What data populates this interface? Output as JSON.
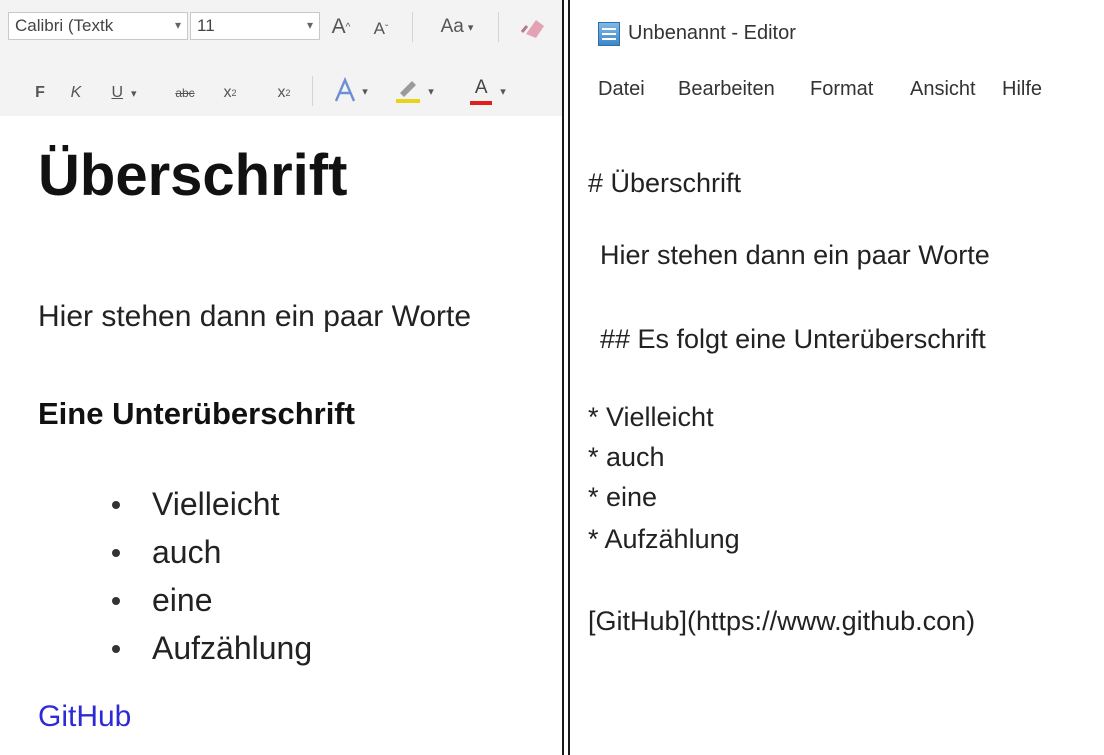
{
  "word": {
    "font_name": "Calibri (Textk",
    "font_size": "11",
    "grow_font": "A",
    "shrink_font": "A",
    "change_case": "Aa",
    "bold": "F",
    "italic": "K",
    "underline": "U",
    "strikethrough": "abc",
    "subscript": "x",
    "superscript": "x",
    "font_color_glyph": "A",
    "heading1": "Überschrift",
    "paragraph": "Hier stehen dann ein paar Worte",
    "heading2": "Eine Unterüberschrift",
    "list": [
      "Vielleicht",
      "auch",
      "eine",
      "Aufzählung"
    ],
    "link": "GitHub",
    "colors": {
      "font_color_underline": "#e0201b",
      "highlight": "#e8d31a",
      "link": "#2e2bd6"
    }
  },
  "notepad": {
    "title": "Unbenannt - Editor",
    "menu": [
      "Datei",
      "Bearbeiten",
      "Format",
      "Ansicht",
      "Hilfe"
    ],
    "lines": [
      "# Überschrift",
      "Hier stehen dann ein paar Worte",
      "## Es folgt eine Unterüberschrift",
      "* Vielleicht",
      "* auch",
      "* eine",
      "* Aufzählung",
      "[GitHub](https://www.github.con)"
    ]
  }
}
